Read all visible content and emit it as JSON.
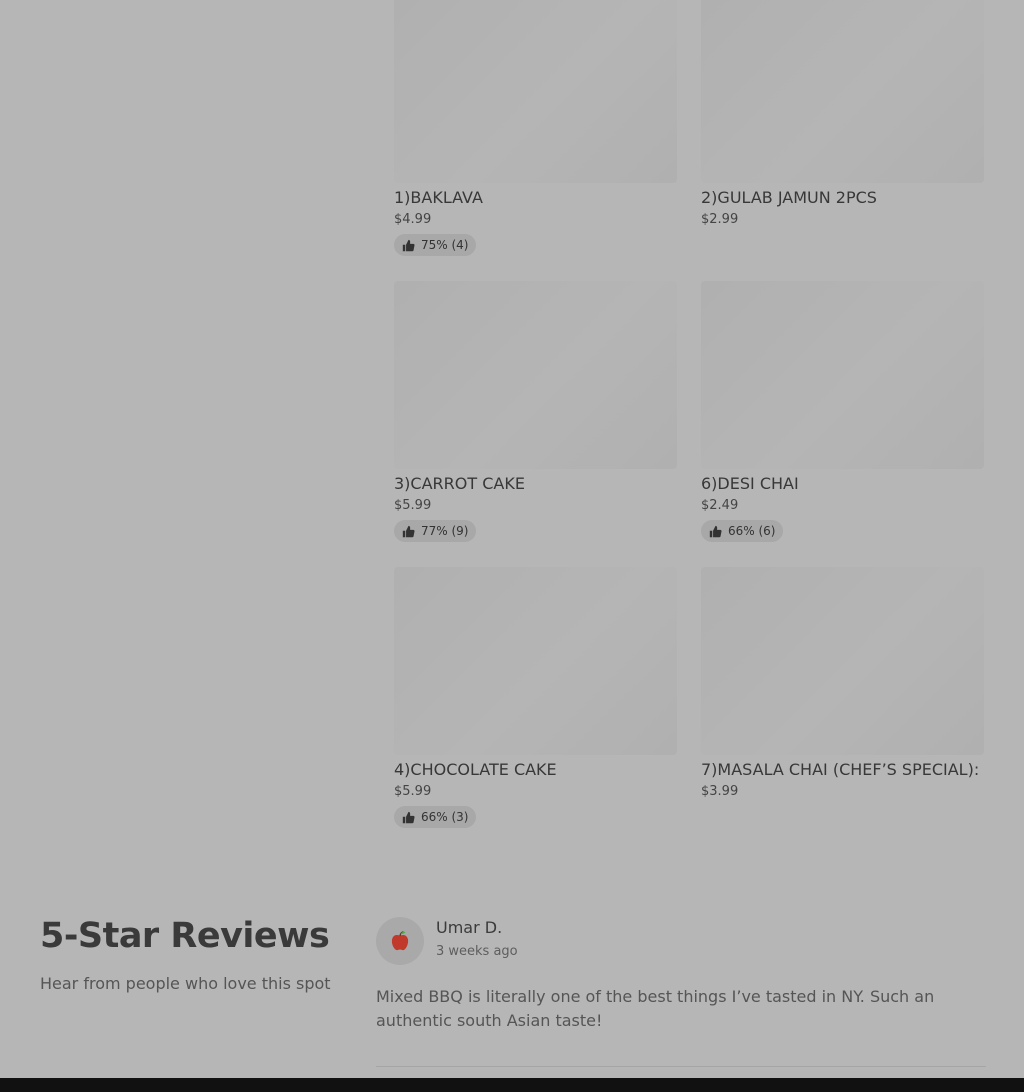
{
  "menu": {
    "items": [
      {
        "name": "1)BAKLAVA",
        "price": "$4.99",
        "rating": "75% (4)"
      },
      {
        "name": "2)GULAB JAMUN 2PCS",
        "price": "$2.99",
        "rating": null
      },
      {
        "name": "3)CARROT CAKE",
        "price": "$5.99",
        "rating": "77% (9)"
      },
      {
        "name": "6)DESI CHAI",
        "price": "$2.49",
        "rating": "66% (6)"
      },
      {
        "name": "4)CHOCOLATE CAKE",
        "price": "$5.99",
        "rating": "66% (3)"
      },
      {
        "name": "7)MASALA CHAI (CHEF’S SPECIAL):",
        "price": "$3.99",
        "rating": null
      }
    ]
  },
  "reviews": {
    "title": "5-Star Reviews",
    "subtitle": "Hear from people who love this spot",
    "items": [
      {
        "reviewer": "Umar D.",
        "time": "3 weeks ago",
        "avatar_icon": "apple-icon",
        "text": "Mixed BBQ is literally one of the best things I’ve tasted in NY. Such an authentic south Asian taste!"
      }
    ]
  },
  "colors": {
    "overlay_background": "#b6b6b6",
    "badge_background": "#a8a8a8",
    "footer_bar": "#111111"
  }
}
